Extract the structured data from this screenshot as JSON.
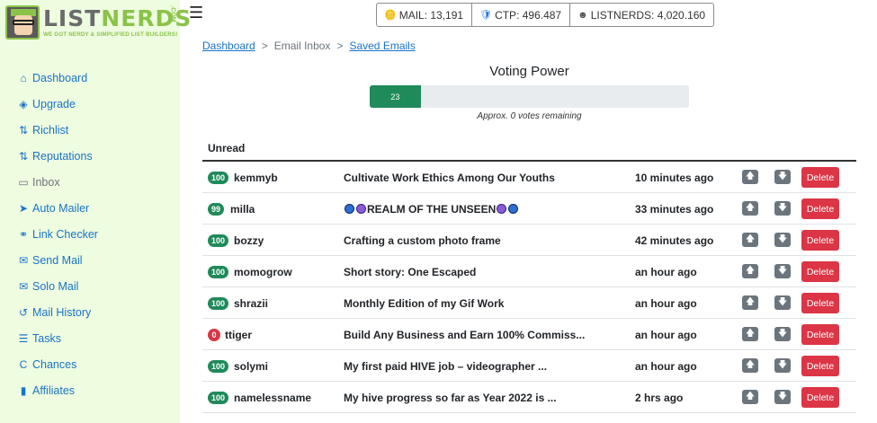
{
  "logo": {
    "brand_part1": "LIST",
    "brand_part2": "NERDS",
    "tagline": "WE GOT NERDY & SIMPLIFIED LIST BUILDERS!",
    "com": ".COM"
  },
  "sidebar": {
    "items": [
      {
        "label": "Dashboard",
        "icon": "home-icon",
        "glyph": "⌂"
      },
      {
        "label": "Upgrade",
        "icon": "layers-icon",
        "glyph": "◈"
      },
      {
        "label": "Richlist",
        "icon": "sort-icon",
        "glyph": "⇅"
      },
      {
        "label": "Reputations",
        "icon": "sort-icon",
        "glyph": "⇅"
      },
      {
        "label": "Inbox",
        "icon": "laptop-icon",
        "glyph": "▭"
      },
      {
        "label": "Auto Mailer",
        "icon": "paper-plane-icon",
        "glyph": "➤"
      },
      {
        "label": "Link Checker",
        "icon": "link-icon",
        "glyph": "⚭"
      },
      {
        "label": "Send Mail",
        "icon": "envelope-icon",
        "glyph": "✉"
      },
      {
        "label": "Solo Mail",
        "icon": "envelope-open-icon",
        "glyph": "✉"
      },
      {
        "label": "Mail History",
        "icon": "history-icon",
        "glyph": "↺"
      },
      {
        "label": "Tasks",
        "icon": "tasks-icon",
        "glyph": "☰"
      },
      {
        "label": "Chances",
        "icon": "chances-icon",
        "glyph": "C"
      },
      {
        "label": "Affiliates",
        "icon": "signal-icon",
        "glyph": "▮"
      }
    ]
  },
  "stats": {
    "mail": "MAIL: 13,191",
    "ctp": "CTP: 496.487",
    "listnerds": "LISTNERDS: 4,020.160"
  },
  "breadcrumb": {
    "dashboard": "Dashboard",
    "sep": ">",
    "email_inbox": "Email Inbox",
    "saved_emails": "Saved Emails"
  },
  "voting": {
    "title": "Voting Power",
    "value": 23,
    "value_label": "23",
    "note": "Approx. 0 votes remaining"
  },
  "table": {
    "header": "Unread",
    "up_glyph": "🡅",
    "down_glyph": "🡇",
    "delete_label": "Delete",
    "rows": [
      {
        "rep": "100",
        "user": "kemmyb",
        "subject": "Cultivate Work Ethics Among Our Youths",
        "time": "10 minutes ago"
      },
      {
        "rep": "99",
        "user": "milla",
        "subject": "REALM OF THE UNSEEN",
        "time": "33 minutes ago"
      },
      {
        "rep": "100",
        "user": "bozzy",
        "subject": "Crafting a custom photo frame",
        "time": "42 minutes ago"
      },
      {
        "rep": "100",
        "user": "momogrow",
        "subject": "Short story: One Escaped",
        "time": "an hour ago"
      },
      {
        "rep": "100",
        "user": "shrazii",
        "subject": "Monthly Edition of my Gif Work",
        "time": "an hour ago"
      },
      {
        "rep": "0",
        "user": "ttiger",
        "subject": "Build Any Business and Earn 100% Commiss...",
        "time": "an hour ago"
      },
      {
        "rep": "100",
        "user": "solymi",
        "subject": "My first paid HIVE job – videographer ...",
        "time": "an hour ago"
      },
      {
        "rep": "100",
        "user": "namelessname",
        "subject": "My hive progress so far as Year 2022 is ...",
        "time": "2 hrs ago"
      }
    ]
  }
}
